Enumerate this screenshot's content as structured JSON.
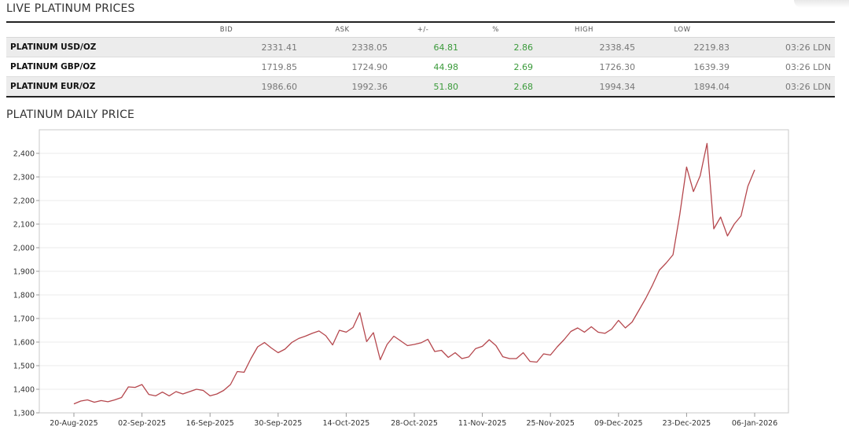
{
  "live_prices": {
    "title": "LIVE PLATINUM PRICES",
    "columns": [
      "",
      "BID",
      "ASK",
      "+/-",
      "%",
      "HIGH",
      "LOW",
      ""
    ],
    "rows": [
      {
        "metal": "PLATINUM USD/OZ",
        "bid": "2331.41",
        "ask": "2338.05",
        "change": "64.81",
        "pct": "2.86",
        "high": "2338.45",
        "low": "2219.83",
        "time": "03:26 LDN"
      },
      {
        "metal": "PLATINUM GBP/OZ",
        "bid": "1719.85",
        "ask": "1724.90",
        "change": "44.98",
        "pct": "2.69",
        "high": "1726.30",
        "low": "1639.39",
        "time": "03:26 LDN"
      },
      {
        "metal": "PLATINUM EUR/OZ",
        "bid": "1986.60",
        "ask": "1992.36",
        "change": "51.80",
        "pct": "2.68",
        "high": "1994.34",
        "low": "1894.04",
        "time": "03:26 LDN"
      }
    ]
  },
  "daily_chart": {
    "title": "PLATINUM DAILY PRICE"
  },
  "chart_data": {
    "type": "line",
    "title": "PLATINUM DAILY PRICE",
    "xlabel": "",
    "ylabel": "",
    "ylim": [
      1300,
      2500
    ],
    "y_ticks": [
      1300,
      1400,
      1500,
      1600,
      1700,
      1800,
      1900,
      2000,
      2100,
      2200,
      2300,
      2400
    ],
    "y_tick_labels": [
      "1,300",
      "1,400",
      "1,500",
      "1,600",
      "1,700",
      "1,800",
      "1,900",
      "2,000",
      "2,100",
      "2,200",
      "2,300",
      "2,400"
    ],
    "x_tick_labels": [
      "20-Aug-2025",
      "02-Sep-2025",
      "16-Sep-2025",
      "30-Sep-2025",
      "14-Oct-2025",
      "28-Oct-2025",
      "11-Nov-2025",
      "25-Nov-2025",
      "09-Dec-2025",
      "23-Dec-2025",
      "06-Jan-2026"
    ],
    "grid": true,
    "line_color": "#b5474d",
    "series": [
      {
        "values": [
          1338,
          1350,
          1355,
          1345,
          1352,
          1347,
          1355,
          1365,
          1410,
          1408,
          1420,
          1378,
          1372,
          1388,
          1372,
          1390,
          1380,
          1390,
          1400,
          1395,
          1372,
          1380,
          1395,
          1420,
          1475,
          1472,
          1530,
          1580,
          1598,
          1575,
          1555,
          1570,
          1598,
          1615,
          1625,
          1637,
          1647,
          1627,
          1588,
          1650,
          1642,
          1662,
          1725,
          1602,
          1640,
          1525,
          1590,
          1625,
          1605,
          1585,
          1590,
          1597,
          1612,
          1560,
          1565,
          1535,
          1555,
          1530,
          1537,
          1572,
          1582,
          1610,
          1585,
          1538,
          1530,
          1530,
          1555,
          1518,
          1515,
          1550,
          1545,
          1580,
          1610,
          1645,
          1660,
          1642,
          1665,
          1642,
          1637,
          1655,
          1692,
          1660,
          1685,
          1735,
          1785,
          1842,
          1905,
          1935,
          1970,
          2140,
          2342,
          2238,
          2305,
          2442,
          2080,
          2130,
          2050,
          2100,
          2135,
          2260,
          2330
        ]
      }
    ]
  }
}
